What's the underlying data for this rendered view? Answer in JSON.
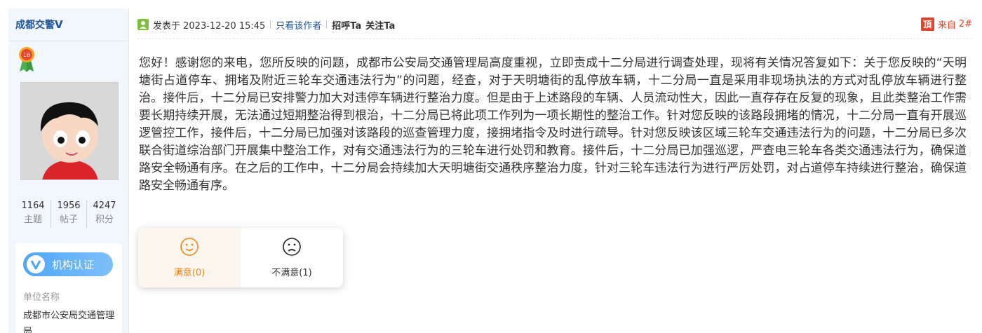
{
  "user": {
    "name": "成都交警",
    "verified_mark": "V",
    "stats": [
      {
        "value": "1164",
        "label": "主题"
      },
      {
        "value": "1956",
        "label": "帖子"
      },
      {
        "value": "4247",
        "label": "积分"
      }
    ],
    "cert_label": "机构认证",
    "unit_label": "单位名称",
    "unit_value": "成都市公安局交通管理局"
  },
  "post": {
    "posted_at": "发表于 2023-12-20 15:45",
    "only_author": "只看该作者",
    "greet": "招呼Ta",
    "follow": "关注Ta",
    "from_icon": "頂",
    "from_label": "来自",
    "floor": "2#",
    "body": "您好！感谢您的来电，您所反映的问题，成都市公安局交通管理局高度重视，立即责成十二分局进行调查处理，现将有关情况答复如下：关于您反映的“天明塘街占道停车、拥堵及附近三轮车交通违法行为”的问题，经查，对于天明塘街的乱停放车辆，十二分局一直是采用非现场执法的方式对乱停放车辆进行整治。接件后，十二分局已安排警力加大对违停车辆进行整治力度。但是由于上述路段的车辆、人员流动性大，因此一直存存在反复的现象，且此类整治工作需要长期持续开展，无法通过短期整治得到根治，十二分局已将此项工作列为一项长期性的整治工作。针对您反映的该路段拥堵的情况，十二分局一直有开展巡逻管控工作，接件后，十二分局已加强对该路段的巡查管理力度，接拥堵指令及时进行疏导。针对您反映该区域三轮车交通违法行为的问题，十二分局已多次联合街道综治部门开展集中整治工作，对有交通违法行为的三轮车进行处罚和教育。接件后，十二分局已加强巡逻，严查电三轮车各类交通违法行为，确保道路安全畅通有序。在之后的工作中，十二分局会持续加大天明塘街交通秩序整治力度，针对三轮车违法行为进行严厉处罚，对占道停车持续进行整治，确保道路安全畅通有序。"
  },
  "rating": {
    "satisfied_label": "满意(0)",
    "unsatisfied_label": "不满意(1)"
  },
  "colors": {
    "link_blue": "#1f5396",
    "accent_red": "#e2432b",
    "satisfied_orange": "#f08519",
    "sidebar_bg": "#f2f7fd"
  },
  "icons": [
    "medal-icon",
    "avatar-image",
    "verified-icon",
    "post-icon",
    "from-icon",
    "smile-icon",
    "frown-icon"
  ]
}
